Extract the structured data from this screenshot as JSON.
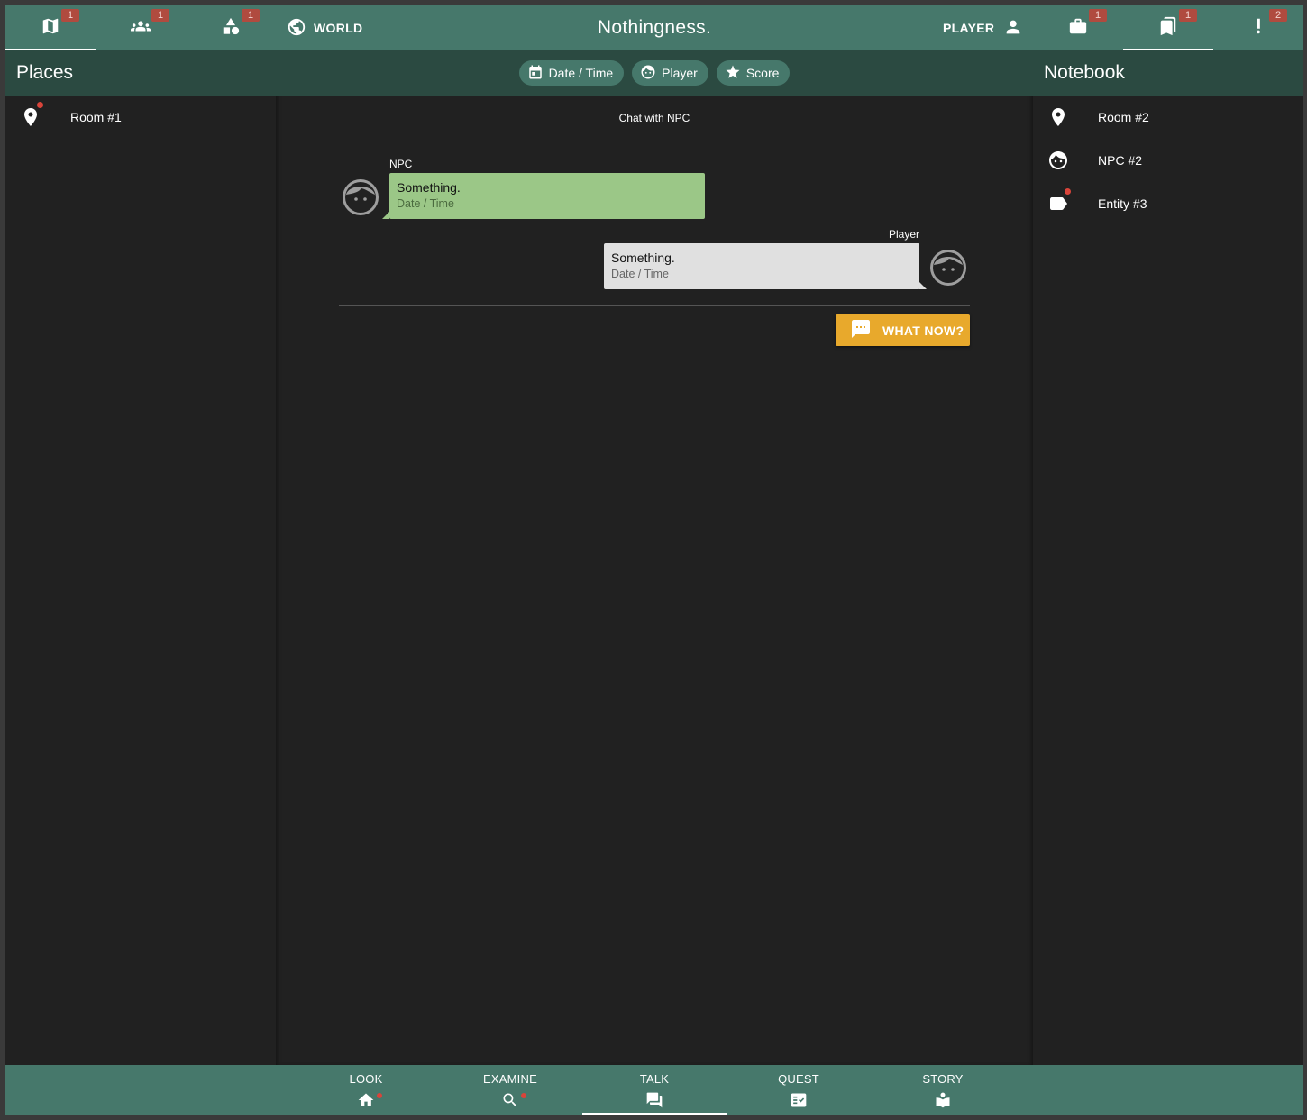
{
  "topbar": {
    "tabs": [
      {
        "icon": "map-icon",
        "badge": "1",
        "active": true
      },
      {
        "icon": "people-icon",
        "badge": "1",
        "active": false
      },
      {
        "icon": "shapes-icon",
        "badge": "1",
        "active": false
      }
    ],
    "world_label": "WORLD",
    "title": "Nothingness.",
    "player_label": "PLAYER",
    "right_tabs": [
      {
        "icon": "briefcase-icon",
        "badge": "1",
        "active": false
      },
      {
        "icon": "bookmarks-icon",
        "badge": "1",
        "active": true
      },
      {
        "icon": "exclamation-icon",
        "badge": "2",
        "active": false
      }
    ]
  },
  "places": {
    "title": "Places",
    "items": [
      {
        "label": "Room #1",
        "icon": "place-pin-icon",
        "unread": true
      }
    ]
  },
  "chips": {
    "date_time": "Date / Time",
    "player": "Player",
    "score": "Score"
  },
  "chat": {
    "title": "Chat with NPC",
    "messages": [
      {
        "sender": "NPC",
        "text": "Something.",
        "time": "Date / Time"
      },
      {
        "sender": "Player",
        "text": "Something.",
        "time": "Date / Time"
      }
    ],
    "action_label": "WHAT NOW?"
  },
  "notebook": {
    "title": "Notebook",
    "items": [
      {
        "label": "Room #2",
        "icon": "place-pin-icon",
        "unread": false
      },
      {
        "label": "NPC #2",
        "icon": "face-icon",
        "unread": false
      },
      {
        "label": "Entity #3",
        "icon": "label-tag-icon",
        "unread": true
      }
    ]
  },
  "bottom_nav": {
    "items": [
      {
        "label": "LOOK",
        "icon": "home-icon",
        "dot": true,
        "active": false
      },
      {
        "label": "EXAMINE",
        "icon": "search-icon",
        "dot": true,
        "active": false
      },
      {
        "label": "TALK",
        "icon": "forum-icon",
        "dot": false,
        "active": true
      },
      {
        "label": "QUEST",
        "icon": "fact-check-icon",
        "dot": false,
        "active": false
      },
      {
        "label": "STORY",
        "icon": "book-reader-icon",
        "dot": false,
        "active": false
      }
    ]
  },
  "colors": {
    "bar": "#46786b",
    "panel_header": "#2b4a41",
    "background": "#212121",
    "badge": "#b04b3f",
    "npc_bubble": "#9bc787",
    "player_bubble": "#e0e0e0",
    "action_button": "#e8a92c",
    "dot": "#d9443a"
  }
}
